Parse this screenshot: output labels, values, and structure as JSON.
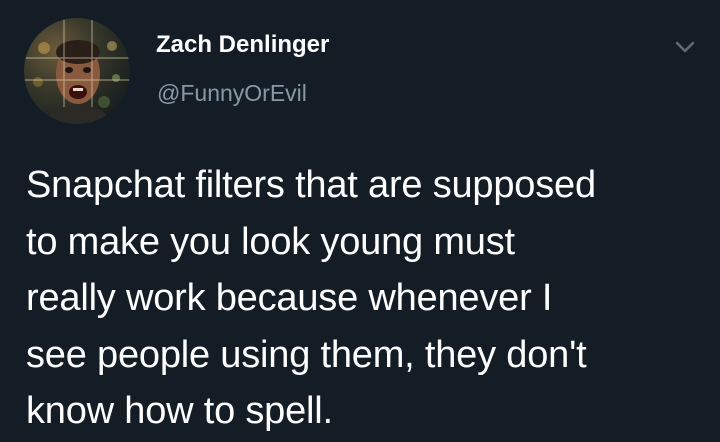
{
  "tweet": {
    "author": {
      "name": "Zach Denlinger",
      "handle": "@FunnyOrEvil",
      "avatar_icon": "avatar-photo"
    },
    "menu_icon": "chevron-down-icon",
    "text_lines": [
      "Snapchat filters that are supposed",
      "to make you look young must",
      "really work because whenever I",
      "see people using them, they don't",
      "know how to spell."
    ]
  },
  "colors": {
    "background": "#141d26",
    "primary_text": "#ffffff",
    "secondary_text": "#8899a6"
  }
}
